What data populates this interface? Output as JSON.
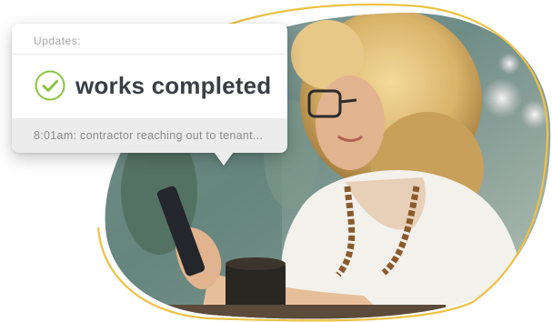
{
  "update_card": {
    "header": "Updates:",
    "status": "works completed",
    "status_icon": "check-circle-icon",
    "footer": "8:01am: contractor reaching out to tenant..."
  },
  "colors": {
    "accent_green": "#8ac53e",
    "outline_yellow": "#ecc245",
    "title_text": "#3a3e44",
    "muted_text": "#a4a4a4"
  }
}
